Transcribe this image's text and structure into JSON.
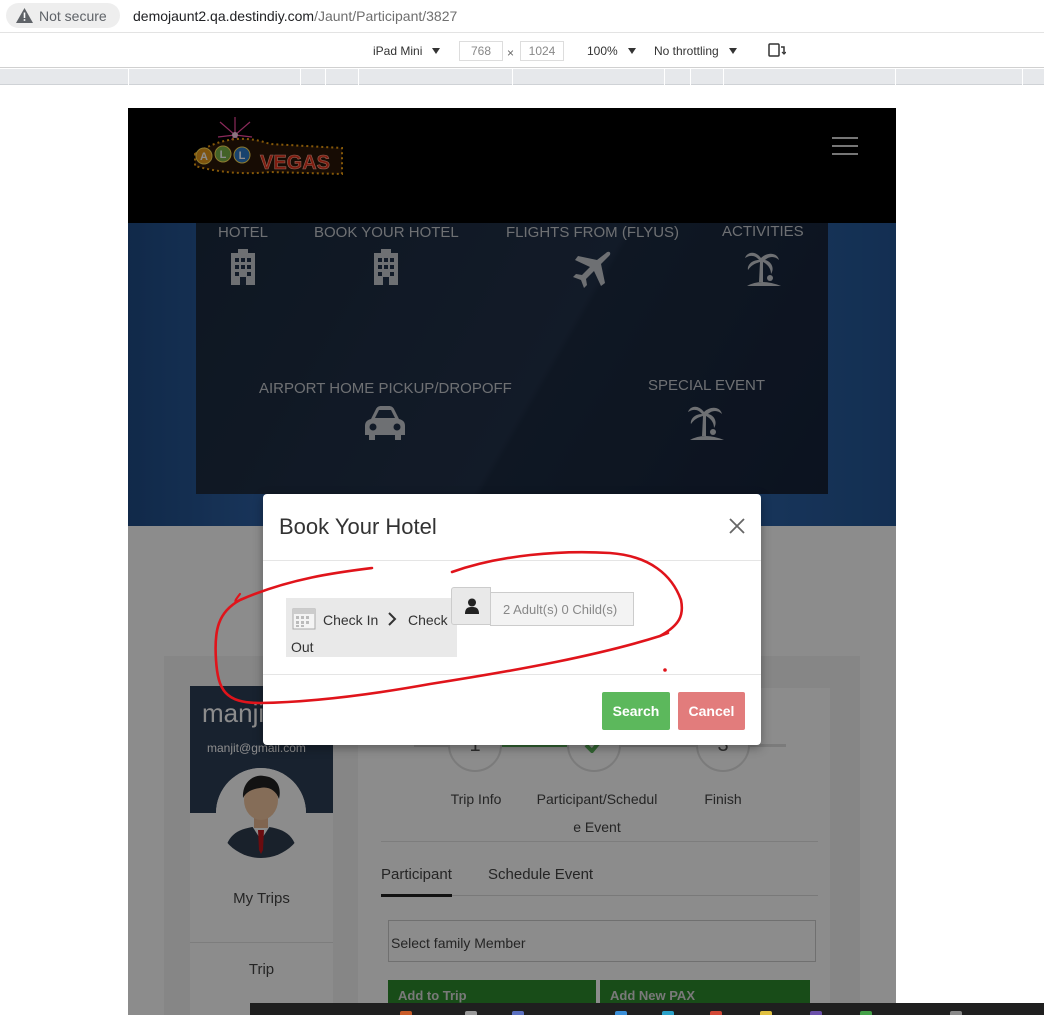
{
  "browser": {
    "security_label": "Not secure",
    "url_host": "demojaunt2.qa.destindiy.com",
    "url_path": "/Jaunt/Participant/3827"
  },
  "devtools": {
    "device": "iPad Mini",
    "width": "768",
    "times": "×",
    "height": "1024",
    "zoom": "100%",
    "throttle": "No throttling"
  },
  "site": {
    "logo_text_left": "ALL",
    "logo_text_right": "VEGAS",
    "menu": [
      {
        "label": "HOTEL",
        "icon": "building-icon"
      },
      {
        "label": "BOOK YOUR HOTEL",
        "icon": "building-icon"
      },
      {
        "label": "FLIGHTS FROM (FLYUS)",
        "icon": "plane-icon"
      },
      {
        "label": "ACTIVITIES",
        "icon": "palm-tree-icon"
      },
      {
        "label": "AIRPORT HOME PICKUP/DROPOFF",
        "icon": "car-icon"
      },
      {
        "label": "SPECIAL EVENT",
        "icon": "palm-tree-icon"
      }
    ]
  },
  "profile": {
    "name": "manjit",
    "email": "manjit@gmail.com",
    "links": [
      "My Trips",
      "Trip"
    ]
  },
  "wizard": {
    "steps": [
      {
        "number": "1",
        "label_line1": "Trip Info",
        "label_line2": ""
      },
      {
        "number": "",
        "label_line1": "Participant/Schedul",
        "label_line2": "e Event"
      },
      {
        "number": "3",
        "label_line1": "Finish",
        "label_line2": ""
      }
    ],
    "tabs": [
      "Participant",
      "Schedule Event"
    ],
    "family_placeholder": "Select family Member",
    "add_trip": "Add to Trip",
    "add_pax": "Add New PAX"
  },
  "modal": {
    "title": "Book Your Hotel",
    "check_in": "Check In",
    "check_out_1": "Check",
    "check_out_2": "Out",
    "guests_value": "2 Adult(s) 0 Child(s)",
    "search_label": "Search",
    "cancel_label": "Cancel"
  },
  "colors": {
    "search_green": "#5cb85c",
    "cancel_red": "#e27c7c",
    "annotation_red": "#e0141b"
  }
}
